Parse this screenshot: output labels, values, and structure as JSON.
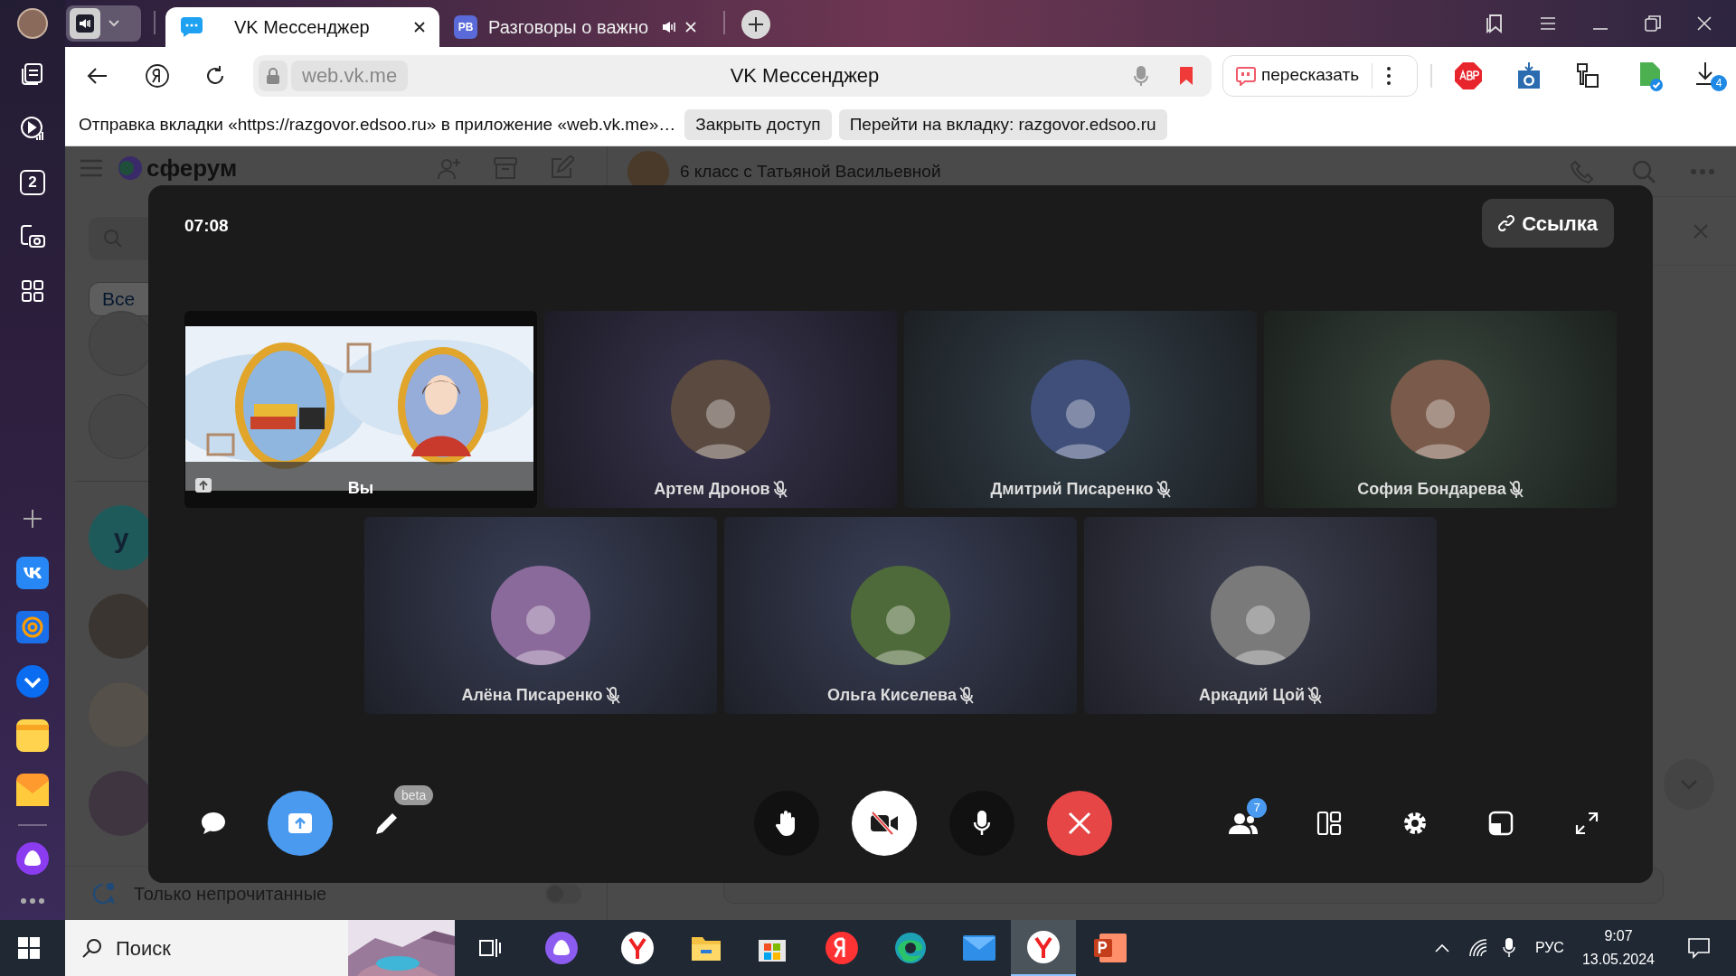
{
  "browser": {
    "tabs": [
      {
        "title": "VK Мессенджер",
        "playing_audio": false,
        "selected": true
      },
      {
        "favicon": "РВ",
        "title": "Разговоры о важно",
        "playing_audio": true,
        "selected": false
      }
    ],
    "address": {
      "site": "web.vk.me",
      "page_title": "VK Мессенджер"
    },
    "retell_button": "пересказать",
    "downloads_count": "4",
    "sidebar_tab_count": "2"
  },
  "share_bar": {
    "message": "Отправка вкладки «https://razgovor.edsoo.ru» в приложение «web.vk.me»…",
    "buttons": [
      "Закрыть доступ",
      "Перейти на вкладку: razgovor.edsoo.ru"
    ]
  },
  "page": {
    "logo": "сферум",
    "filter_chip": "Все",
    "contact_initial": "у",
    "unread_only": {
      "label": "Только непрочитанные",
      "on": false
    },
    "chat_title": "6 класс с Татьяной Васильевной"
  },
  "call": {
    "timer": "07:08",
    "link_button": "Ссылка",
    "tiles": [
      {
        "kind": "screen",
        "name": "Вы",
        "muted": false
      },
      {
        "kind": "avatar",
        "name": "Артем Дронов",
        "muted": true
      },
      {
        "kind": "avatar",
        "name": "Дмитрий Писаренко",
        "muted": true
      },
      {
        "kind": "avatar",
        "name": "София Бондарева",
        "muted": true
      },
      {
        "kind": "avatar",
        "name": "Алёна Писаренко",
        "muted": true
      },
      {
        "kind": "avatar",
        "name": "Ольга Киселева",
        "muted": true
      },
      {
        "kind": "avatar",
        "name": "Аркадий Цой",
        "muted": true
      }
    ],
    "draw_badge": "beta",
    "participants_count": "7",
    "screen_sharing": true,
    "camera_on": false
  },
  "taskbar": {
    "search": "Поиск",
    "language": "РУС",
    "time": "9:07",
    "date": "13.05.2024"
  }
}
